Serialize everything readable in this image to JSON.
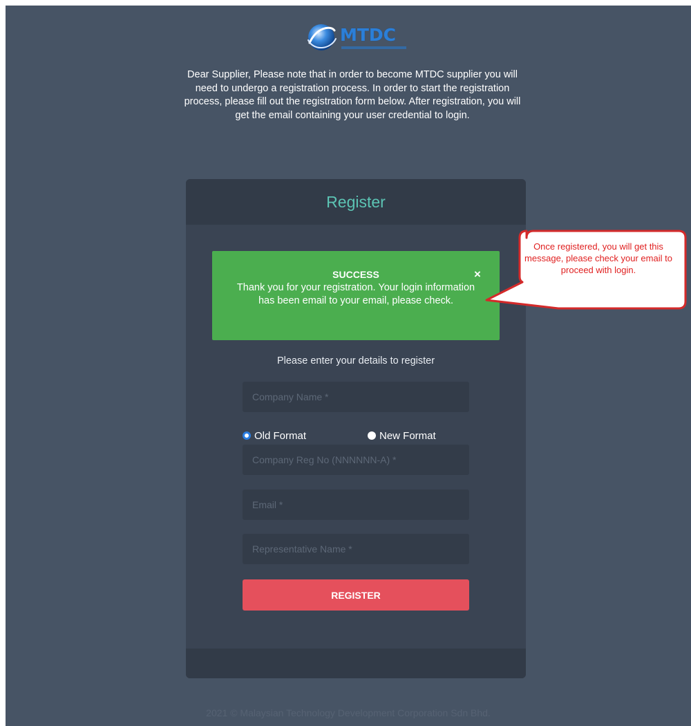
{
  "logo": {
    "brand": "MTDC"
  },
  "intro_text": "Dear Supplier, Please note that in order to become MTDC supplier you will need to undergo a registration process. In order to start the registration process, please fill out the registration form below. After registration, you will get the email containing your user credential to login.",
  "card": {
    "title": "Register",
    "alert": {
      "title": "SUCCESS",
      "message": "Thank you for your registration. Your login information has been email to your email, please check.",
      "close_icon": "close-icon",
      "color": "#4bae4f"
    },
    "instructions": "Please enter your details to register",
    "form": {
      "company_name_placeholder": "Company Name *",
      "format_options": [
        {
          "label": "Old Format",
          "checked": true
        },
        {
          "label": "New Format",
          "checked": false
        }
      ],
      "company_reg_placeholder": "Company Reg No (NNNNNN-A) *",
      "email_placeholder": "Email *",
      "rep_name_placeholder": "Representative Name *",
      "register_label": "REGISTER"
    }
  },
  "callout": {
    "text": "Once registered, you will get this message, please check your email to proceed with login.",
    "color": "#e02020"
  },
  "footer": {
    "copyright": "2021 © Malaysian Technology Development Corporation Sdn Bhd."
  },
  "colors": {
    "background": "#475465",
    "card": "#3a4453",
    "accent_title": "#5cc4b4",
    "button": "#e5505c"
  }
}
